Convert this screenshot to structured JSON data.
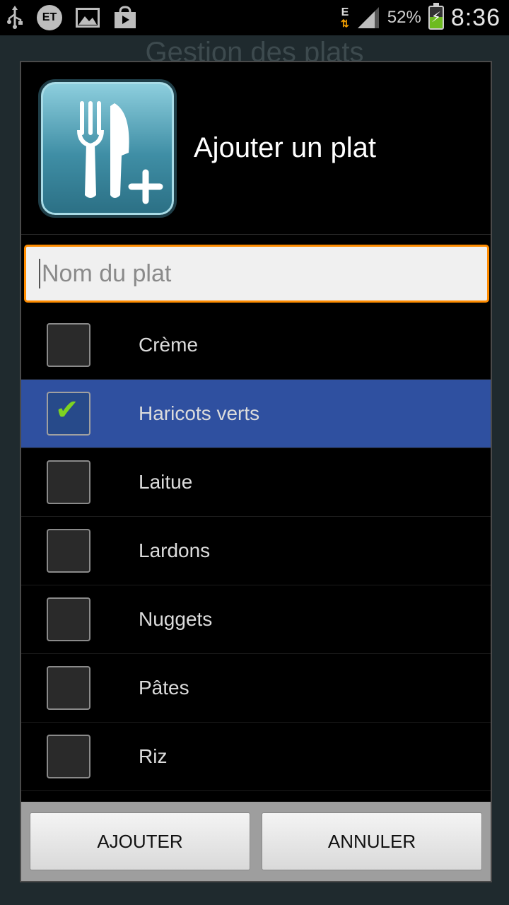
{
  "status_bar": {
    "icons": [
      "usb-icon",
      "et-icon",
      "image-icon",
      "store-icon"
    ],
    "et_label": "ET",
    "network_label": "E",
    "battery_percent": "52%",
    "battery_level": 0.52,
    "time": "8:36"
  },
  "background": {
    "title": "Gestion des plats"
  },
  "dialog": {
    "title": "Ajouter un plat",
    "icon": "cutlery-add-icon",
    "input": {
      "value": "",
      "placeholder": "Nom du plat"
    },
    "items": [
      {
        "label": "Crème",
        "checked": false
      },
      {
        "label": "Haricots verts",
        "checked": true
      },
      {
        "label": "Laitue",
        "checked": false
      },
      {
        "label": "Lardons",
        "checked": false
      },
      {
        "label": "Nuggets",
        "checked": false
      },
      {
        "label": "Pâtes",
        "checked": false
      },
      {
        "label": "Riz",
        "checked": false
      }
    ],
    "buttons": {
      "add": "AJOUTER",
      "cancel": "ANNULER"
    }
  },
  "colors": {
    "accent": "#ff8c00",
    "selected_row": "#2f50a0",
    "check": "#7ed321"
  }
}
